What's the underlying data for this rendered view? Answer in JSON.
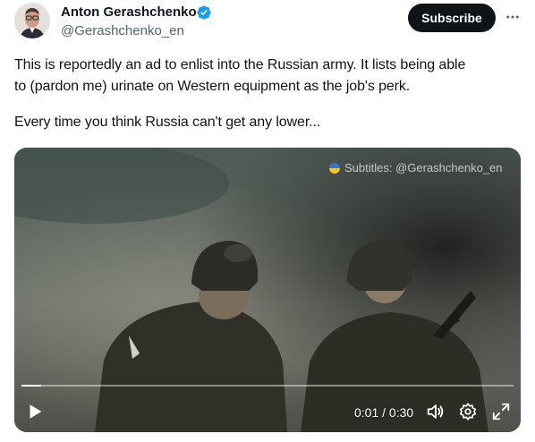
{
  "author": {
    "name": "Anton Gerashchenko",
    "handle": "@Gerashchenko_en",
    "verified_color": "#1d9bf0"
  },
  "header": {
    "subscribe_label": "Subscribe",
    "more_icon": "more-horizontal-icon"
  },
  "tweet": {
    "lines": [
      "This is reportedly an ad to enlist into the Russian army. It lists being able",
      "to (pardon me) urinate on Western equipment as the job's perk.",
      "Every time you think Russia can't get any lower..."
    ]
  },
  "video": {
    "watermark": "Subtitles: @Gerashchenko_en",
    "time_display": "0:01 / 0:30",
    "progress": 0.04,
    "controls": [
      "play-icon",
      "volume-icon",
      "settings-icon",
      "fullscreen-icon"
    ]
  }
}
